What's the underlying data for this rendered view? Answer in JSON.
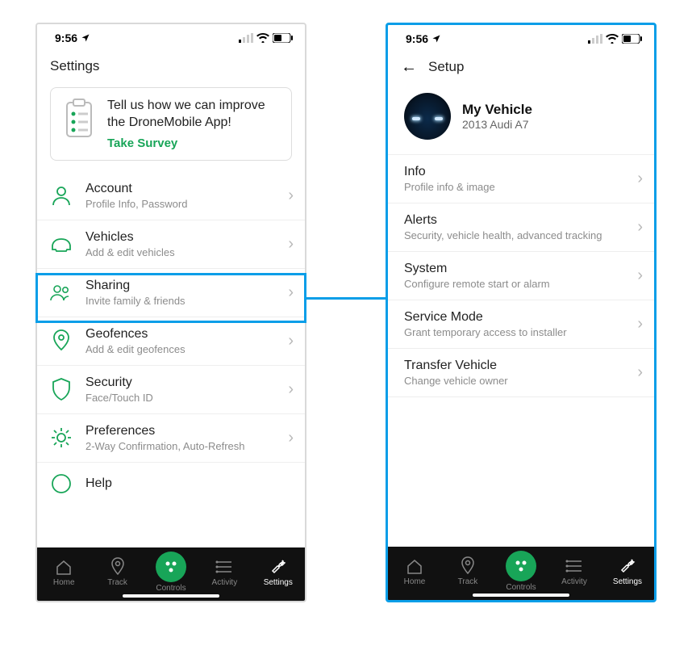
{
  "statusbar": {
    "time": "9:56"
  },
  "left": {
    "header_title": "Settings",
    "survey": {
      "text": "Tell us how we can improve the DroneMobile App!",
      "link": "Take Survey"
    },
    "items": [
      {
        "label": "Account",
        "sub": "Profile Info, Password"
      },
      {
        "label": "Vehicles",
        "sub": "Add & edit vehicles"
      },
      {
        "label": "Sharing",
        "sub": "Invite family & friends"
      },
      {
        "label": "Geofences",
        "sub": "Add & edit geofences"
      },
      {
        "label": "Security",
        "sub": "Face/Touch ID"
      },
      {
        "label": "Preferences",
        "sub": "2-Way Confirmation, Auto-Refresh"
      }
    ],
    "help_label": "Help"
  },
  "right": {
    "header_title": "Setup",
    "vehicle": {
      "name": "My Vehicle",
      "sub": "2013 Audi A7"
    },
    "items": [
      {
        "label": "Info",
        "sub": "Profile info & image"
      },
      {
        "label": "Alerts",
        "sub": "Security, vehicle health, advanced tracking"
      },
      {
        "label": "System",
        "sub": "Configure remote start or alarm"
      },
      {
        "label": "Service Mode",
        "sub": "Grant temporary access to installer"
      },
      {
        "label": "Transfer Vehicle",
        "sub": "Change vehicle owner"
      }
    ]
  },
  "tabs": {
    "home": "Home",
    "track": "Track",
    "controls": "Controls",
    "activity": "Activity",
    "settings": "Settings"
  }
}
